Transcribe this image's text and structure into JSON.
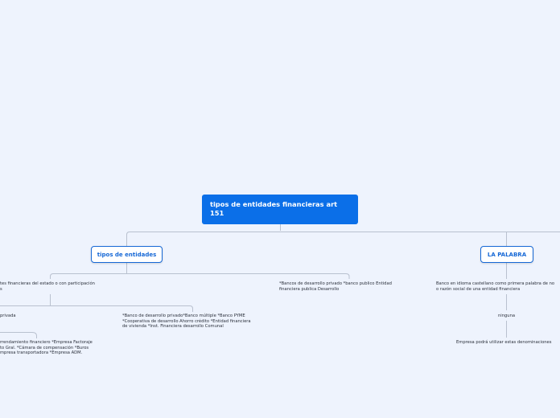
{
  "mindmap": {
    "root": {
      "label": "tipos de entidades financieras art 151"
    },
    "branches": [
      {
        "label": "tipos de entidades",
        "children": [
          {
            "label": "tes financieras del estado o con participación\ns",
            "children": [
              {
                "label": "privada",
                "children": [
                  {
                    "label": "rrendamiento financiero *Empresa Factoraje\nto Gral. *Cámara de compensación *Buros\nmpresa transportadora *Empresa ADM."
                  }
                ]
              },
              {
                "label": "*Banco de desarrollo privado*Banco múltiple *Banco PYME\n*Cooperativa de desarrollo Ahorro crédito *Entidad financiera\nde vivienda *Inst. Financiera desarrollo Comunal"
              }
            ]
          },
          {
            "label": "*Bancos de desarrollo privado *banco publico  Entidad\nfinanciera publica Desarrollo"
          }
        ]
      },
      {
        "label": "LA PALABRA",
        "children": [
          {
            "label": "Banco en idioma castellano como primera palabra de no\no razón social de una entidad financiera",
            "children": [
              {
                "label": "ninguna",
                "children": [
                  {
                    "label": "Empresa podrá utilizar estas denominaciones"
                  }
                ]
              }
            ]
          }
        ]
      }
    ]
  }
}
